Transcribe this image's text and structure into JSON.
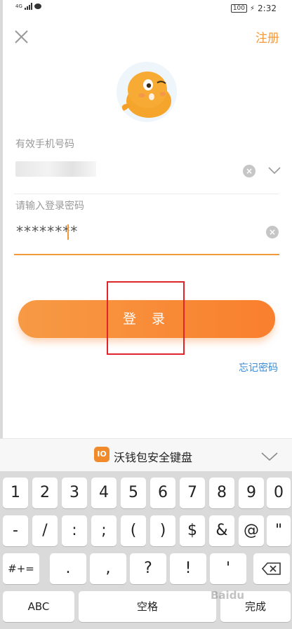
{
  "status_bar": {
    "network": "4G",
    "battery": "100",
    "time": "2:32"
  },
  "header": {
    "register_label": "注册"
  },
  "form": {
    "phone_label": "有效手机号码",
    "password_label": "请输入登录密码",
    "password_value": "********"
  },
  "login_button_label": "登 录",
  "forgot_password_label": "忘记密码",
  "keyboard": {
    "title": "沃钱包安全键盘",
    "logo_text": "IO",
    "row1": [
      "1",
      "2",
      "3",
      "4",
      "5",
      "6",
      "7",
      "8",
      "9",
      "0"
    ],
    "row2": [
      "-",
      "/",
      ":",
      ";",
      "(",
      ")",
      "$",
      "&",
      "@",
      "\""
    ],
    "row3": [
      "#+=",
      ".",
      ",",
      "?",
      "!",
      "'"
    ],
    "row4": [
      "ABC",
      "空格",
      "完成"
    ]
  },
  "watermark": "Baidu",
  "colors": {
    "accent": "#f29a3a",
    "link": "#3a8ad6",
    "annotation": "#e0242b"
  }
}
